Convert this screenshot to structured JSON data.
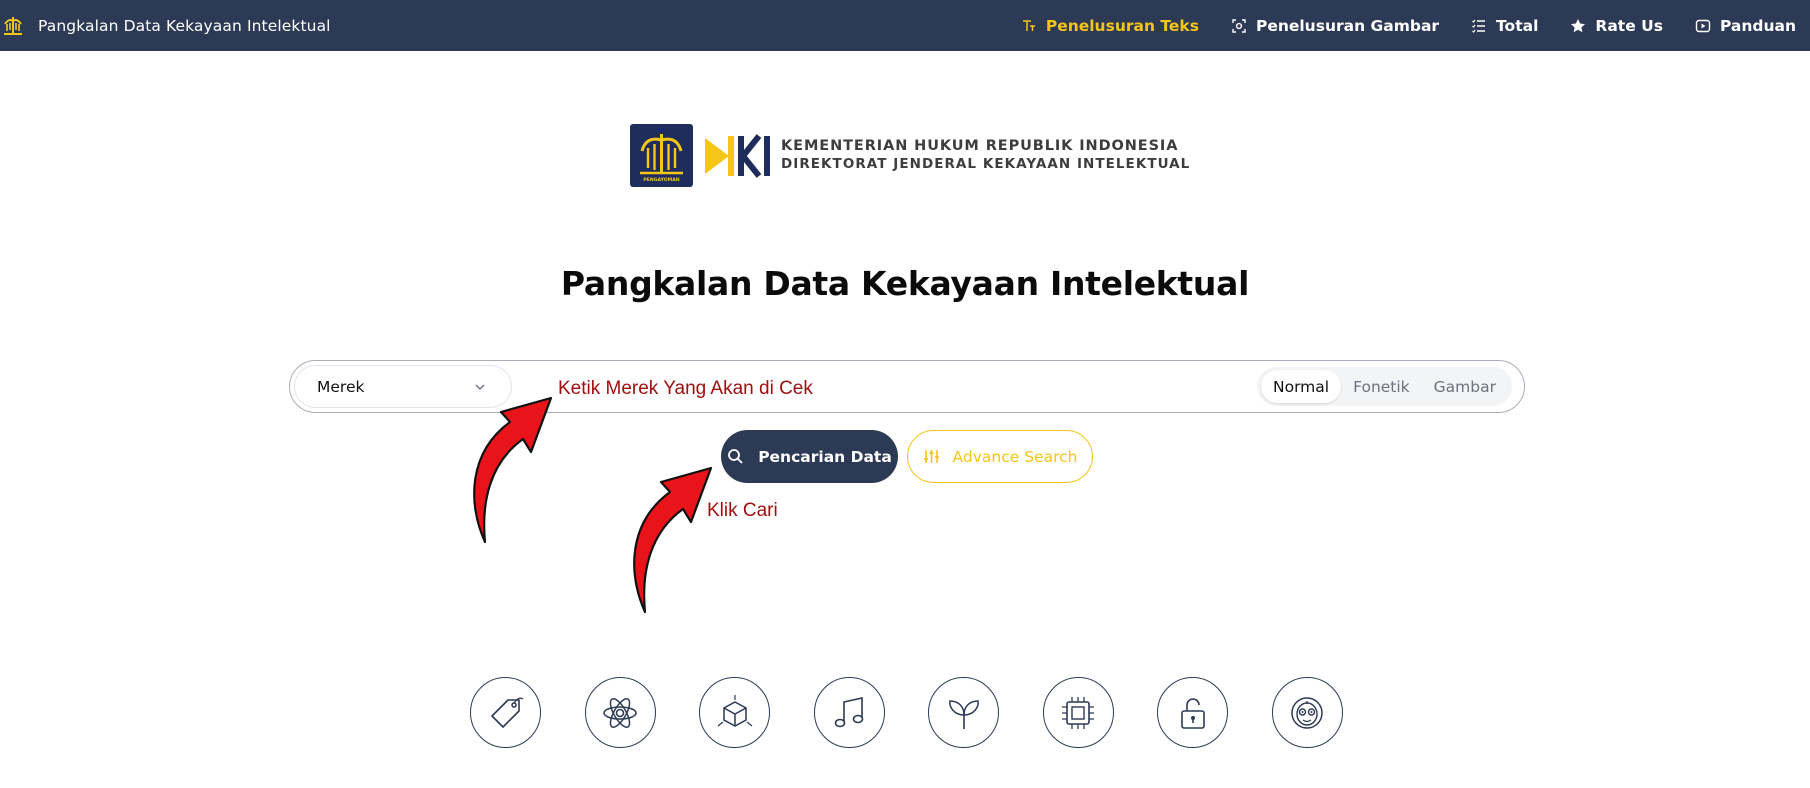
{
  "navbar": {
    "brand_title": "Pangkalan Data Kekayaan Intelektual",
    "items": [
      {
        "label": "Penelusuran Teks",
        "icon": "text-icon",
        "active": true
      },
      {
        "label": "Penelusuran Gambar",
        "icon": "image-scan-icon",
        "active": false
      },
      {
        "label": "Total",
        "icon": "list-icon",
        "active": false
      },
      {
        "label": "Rate Us",
        "icon": "star-icon",
        "active": false
      },
      {
        "label": "Panduan",
        "icon": "play-icon",
        "active": false
      }
    ]
  },
  "logo": {
    "emblem_caption": "PENGAYOMAN",
    "line1": "KEMENTERIAN HUKUM REPUBLIK INDONESIA",
    "line2": "DIREKTORAT JENDERAL KEKAYAAN INTELEKTUAL"
  },
  "main": {
    "title": "Pangkalan Data Kekayaan Intelektual"
  },
  "search": {
    "category_value": "Merek",
    "input_value": "",
    "modes": [
      {
        "label": "Normal",
        "active": true
      },
      {
        "label": "Fonetik",
        "active": false
      },
      {
        "label": "Gambar",
        "active": false
      }
    ],
    "search_button": "Pencarian Data",
    "advance_button": "Advance Search"
  },
  "annotations": {
    "input_hint": "Ketik Merek Yang Akan di Cek",
    "click_hint": "Klik Cari"
  },
  "categories": [
    {
      "icon": "tag-icon"
    },
    {
      "icon": "atom-icon"
    },
    {
      "icon": "cube-icon"
    },
    {
      "icon": "music-note-icon"
    },
    {
      "icon": "sprout-icon"
    },
    {
      "icon": "chip-icon"
    },
    {
      "icon": "unlock-icon"
    },
    {
      "icon": "mask-icon"
    }
  ],
  "colors": {
    "navbar_bg": "#2d3a55",
    "accent_yellow": "#f5c518",
    "annotation_red": "#a10f10"
  }
}
